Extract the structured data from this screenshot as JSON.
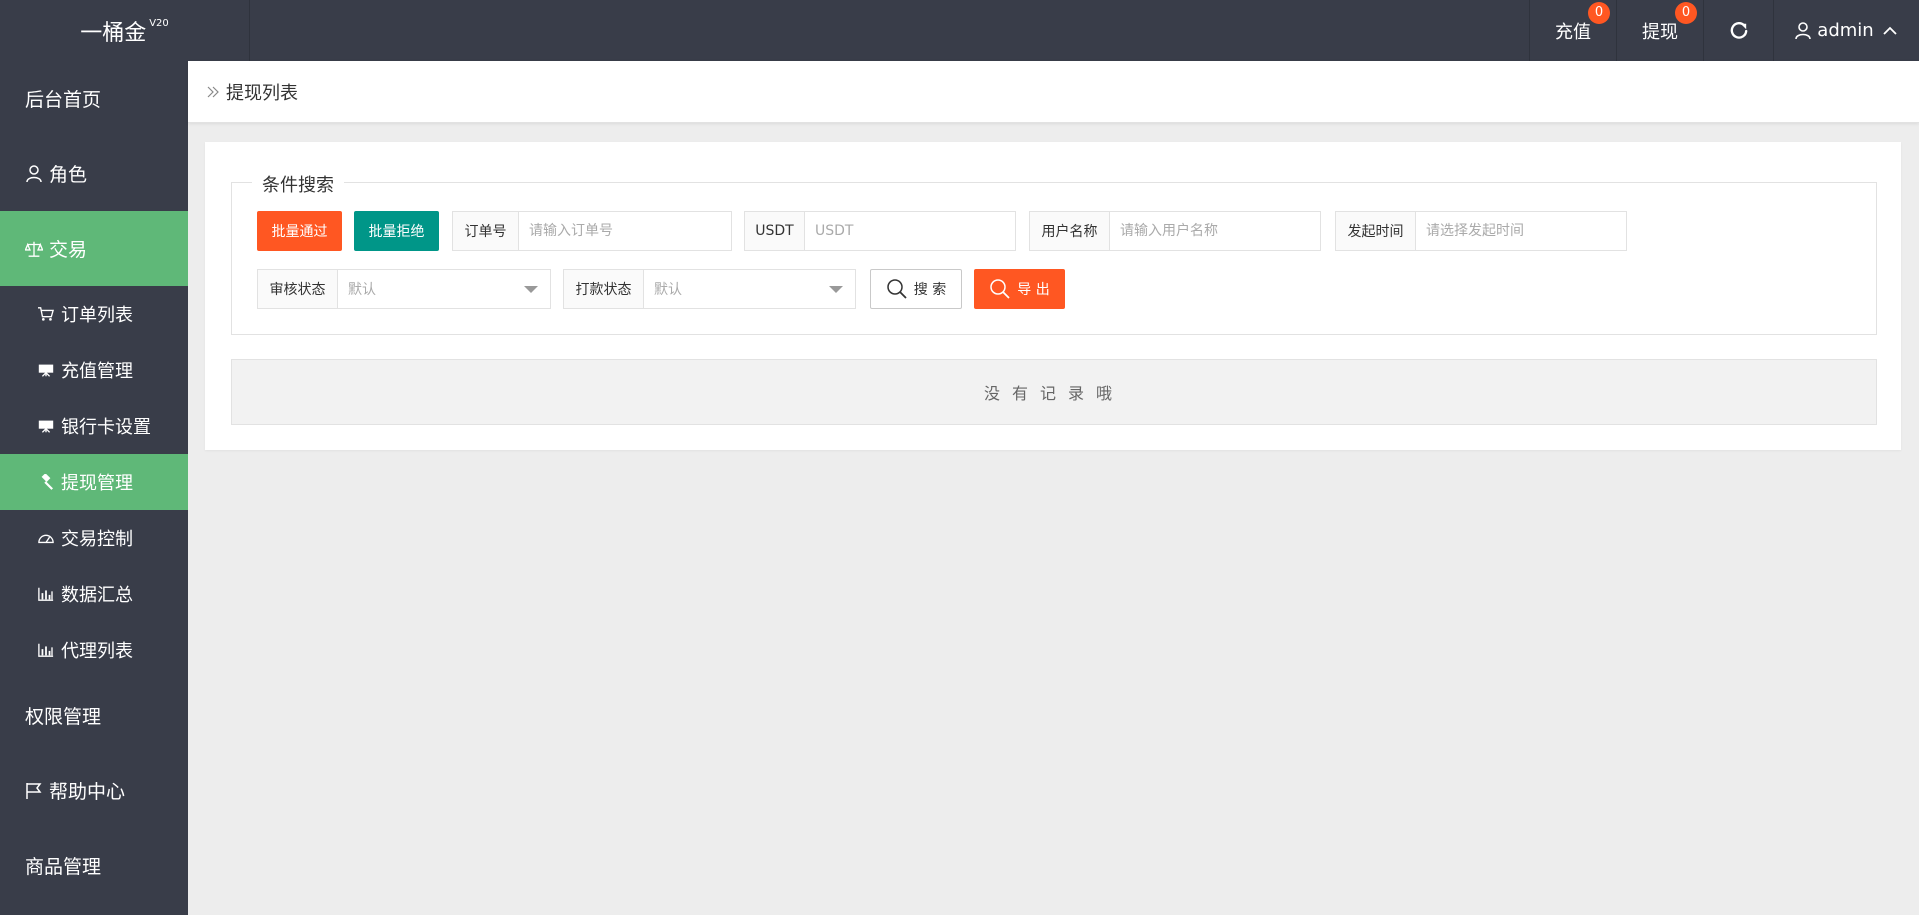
{
  "app": {
    "name": "一桶金",
    "version": "V20"
  },
  "topbar": {
    "recharge_label": "充值",
    "recharge_badge": "0",
    "withdraw_label": "提现",
    "withdraw_badge": "0",
    "user_name": "admin"
  },
  "sidebar": {
    "items": [
      {
        "label": "后台首页",
        "icon": ""
      },
      {
        "label": "角色",
        "icon": "user-icon"
      },
      {
        "label": "交易",
        "icon": "scale-icon"
      },
      {
        "label": "订单列表",
        "icon": "cart-icon"
      },
      {
        "label": "充值管理",
        "icon": "board-icon"
      },
      {
        "label": "银行卡设置",
        "icon": "board-icon"
      },
      {
        "label": "提现管理",
        "icon": "gavel-icon"
      },
      {
        "label": "交易控制",
        "icon": "dashboard-icon"
      },
      {
        "label": "数据汇总",
        "icon": "bar-chart-icon"
      },
      {
        "label": "代理列表",
        "icon": "bar-chart-icon"
      },
      {
        "label": "权限管理",
        "icon": ""
      },
      {
        "label": "帮助中心",
        "icon": "flag-icon"
      },
      {
        "label": "商品管理",
        "icon": ""
      }
    ]
  },
  "breadcrumb": {
    "current": "提现列表"
  },
  "search": {
    "legend": "条件搜索",
    "batch_approve_label": "批量通过",
    "batch_reject_label": "批量拒绝",
    "order_no_label": "订单号",
    "order_no_placeholder": "请输入订单号",
    "usdt_label": "USDT",
    "usdt_placeholder": "USDT",
    "username_label": "用户名称",
    "username_placeholder": "请输入用户名称",
    "start_time_label": "发起时间",
    "start_time_placeholder": "请选择发起时间",
    "audit_status_label": "审核状态",
    "audit_status_value": "默认",
    "payment_status_label": "打款状态",
    "payment_status_value": "默认",
    "search_button_label": "搜 索",
    "export_button_label": "导 出"
  },
  "table": {
    "empty_text": "没有记录哦"
  },
  "colors": {
    "sidebar_bg": "#393d49",
    "active_green": "#5fb878",
    "orange": "#ff5722",
    "teal": "#009688"
  }
}
